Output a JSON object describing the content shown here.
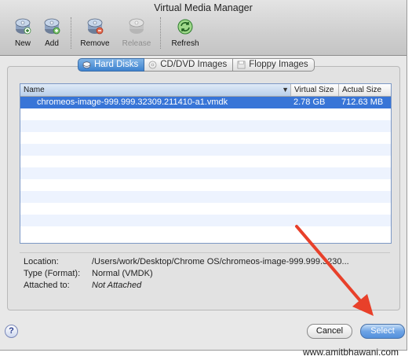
{
  "window": {
    "title": "Virtual Media Manager"
  },
  "toolbar": {
    "new_label": "New",
    "add_label": "Add",
    "remove_label": "Remove",
    "release_label": "Release",
    "refresh_label": "Refresh"
  },
  "tabs": [
    {
      "label": "Hard Disks",
      "icon": "hard-disk-icon",
      "active": true
    },
    {
      "label": "CD/DVD Images",
      "icon": "cd-icon",
      "active": false
    },
    {
      "label": "Floppy Images",
      "icon": "floppy-icon",
      "active": false
    }
  ],
  "table": {
    "columns": {
      "name": "Name",
      "virtual_size": "Virtual Size",
      "actual_size": "Actual Size"
    },
    "rows": [
      {
        "name": "chromeos-image-999.999.32309.211410-a1.vmdk",
        "virtual_size": "2.78 GB",
        "actual_size": "712.63 MB",
        "selected": true
      }
    ]
  },
  "details": {
    "location_label": "Location:",
    "location_value": "/Users/work/Desktop/Chrome OS/chromeos-image-999.999.3230...",
    "type_label": "Type (Format):",
    "type_value": "Normal (VMDK)",
    "attached_label": "Attached to:",
    "attached_value": "Not Attached"
  },
  "buttons": {
    "help": "?",
    "cancel": "Cancel",
    "select": "Select"
  },
  "watermark": "www.amitbhawani.com",
  "colors": {
    "selection": "#3875d7",
    "arrow": "#e8402a",
    "default_button": "#5390dc"
  }
}
